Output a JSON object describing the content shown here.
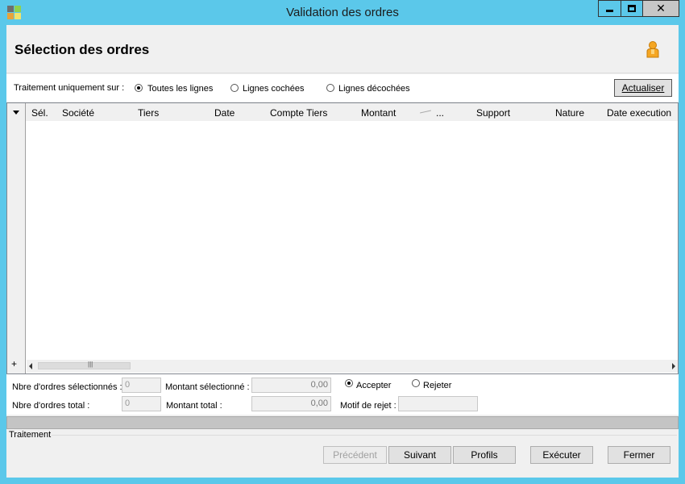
{
  "window": {
    "title": "Validation des ordres",
    "min_symbol": "",
    "close_symbol": "✕"
  },
  "header": {
    "page_title": "Sélection des ordres"
  },
  "filter": {
    "label": "Traitement uniquement sur :",
    "options": [
      {
        "label": "Toutes les lignes",
        "selected": true
      },
      {
        "label": "Lignes cochées",
        "selected": false
      },
      {
        "label": "Lignes décochées",
        "selected": false
      }
    ],
    "refresh_label": "Actualiser"
  },
  "grid": {
    "columns": [
      "Sél.",
      "Société",
      "Tiers",
      "Date",
      "Compte Tiers",
      "Montant",
      "...",
      "Support",
      "Nature",
      "Date execution"
    ],
    "rows": [],
    "add_symbol": "+",
    "grip": "|||"
  },
  "summary": {
    "selected_count_label": "Nbre d'ordres sélectionnés :",
    "selected_count_value": "0",
    "total_count_label": "Nbre d'ordres total :",
    "total_count_value": "0",
    "selected_amount_label": "Montant sélectionné :",
    "selected_amount_value": "0,00",
    "total_amount_label": "Montant total :",
    "total_amount_value": "0,00",
    "accept_label": "Accepter",
    "reject_label": "Rejeter",
    "decision_selected": "accept",
    "reject_reason_label": "Motif de rejet :",
    "reject_reason_value": ""
  },
  "footer": {
    "group_label": "Traitement",
    "previous_label": "Précédent",
    "next_label": "Suivant",
    "profiles_label": "Profils",
    "execute_label": "Exécuter",
    "close_label": "Fermer"
  },
  "colors": {
    "chrome": "#5bc8ea",
    "panel": "#f0f0f0",
    "button": "#e1e1e1"
  }
}
